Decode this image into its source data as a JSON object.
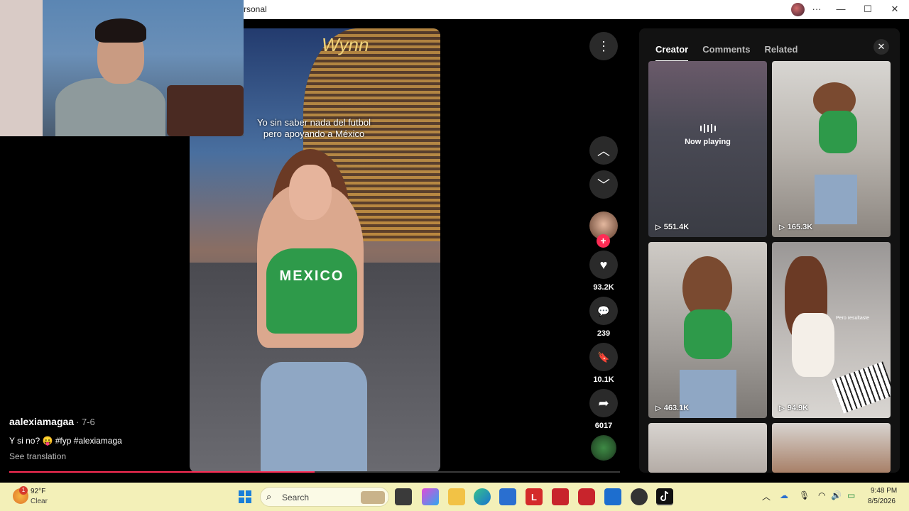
{
  "window": {
    "title": "rsonal",
    "minimize": "—",
    "maximize": "☐",
    "close": "✕",
    "menu": "···"
  },
  "video": {
    "caption_line1": "Yo sin saber nada del futbol",
    "caption_line2": "pero apoyando a México",
    "shirt_text": "MEXICO",
    "sign_text": "Wynn",
    "progress": 0.5
  },
  "info": {
    "author": "aalexiamagaa",
    "date": "· 7-6",
    "description": "Y si no? 😛 #fyp #alexiamaga",
    "see_translation": "See translation"
  },
  "actions": {
    "more_icon": "⋮",
    "up_icon": "︿",
    "down_icon": "﹀",
    "like_icon": "♥",
    "comment_icon": "💬",
    "save_icon": "🔖",
    "share_icon": "➦",
    "follow_icon": "+",
    "likes": "93.2K",
    "comments": "239",
    "saves": "10.1K",
    "shares": "6017"
  },
  "panel": {
    "tabs": [
      "Creator",
      "Comments",
      "Related"
    ],
    "close_icon": "✕",
    "now_playing": "Now playing",
    "play_icon": "▷",
    "thumb_overlay": "Pero resultaste",
    "thumbnails": [
      {
        "views": "551.4K",
        "now_playing": true
      },
      {
        "views": "165.3K"
      },
      {
        "views": "463.1K"
      },
      {
        "views": "94.9K"
      }
    ]
  },
  "taskbar": {
    "weather_badge": "1",
    "temperature": "92°F",
    "condition": "Clear",
    "search_icon": "⌕",
    "search_placeholder": "Search",
    "app_letter_l": "L",
    "clock_time": "9:48 PM",
    "clock_date": "8/5/2026",
    "tray_chevron": "︿",
    "tray_cloud": "☁",
    "tray_mic": "🎙",
    "tray_wifi": "◠",
    "tray_volume": "🔊",
    "tray_battery": "▭"
  }
}
